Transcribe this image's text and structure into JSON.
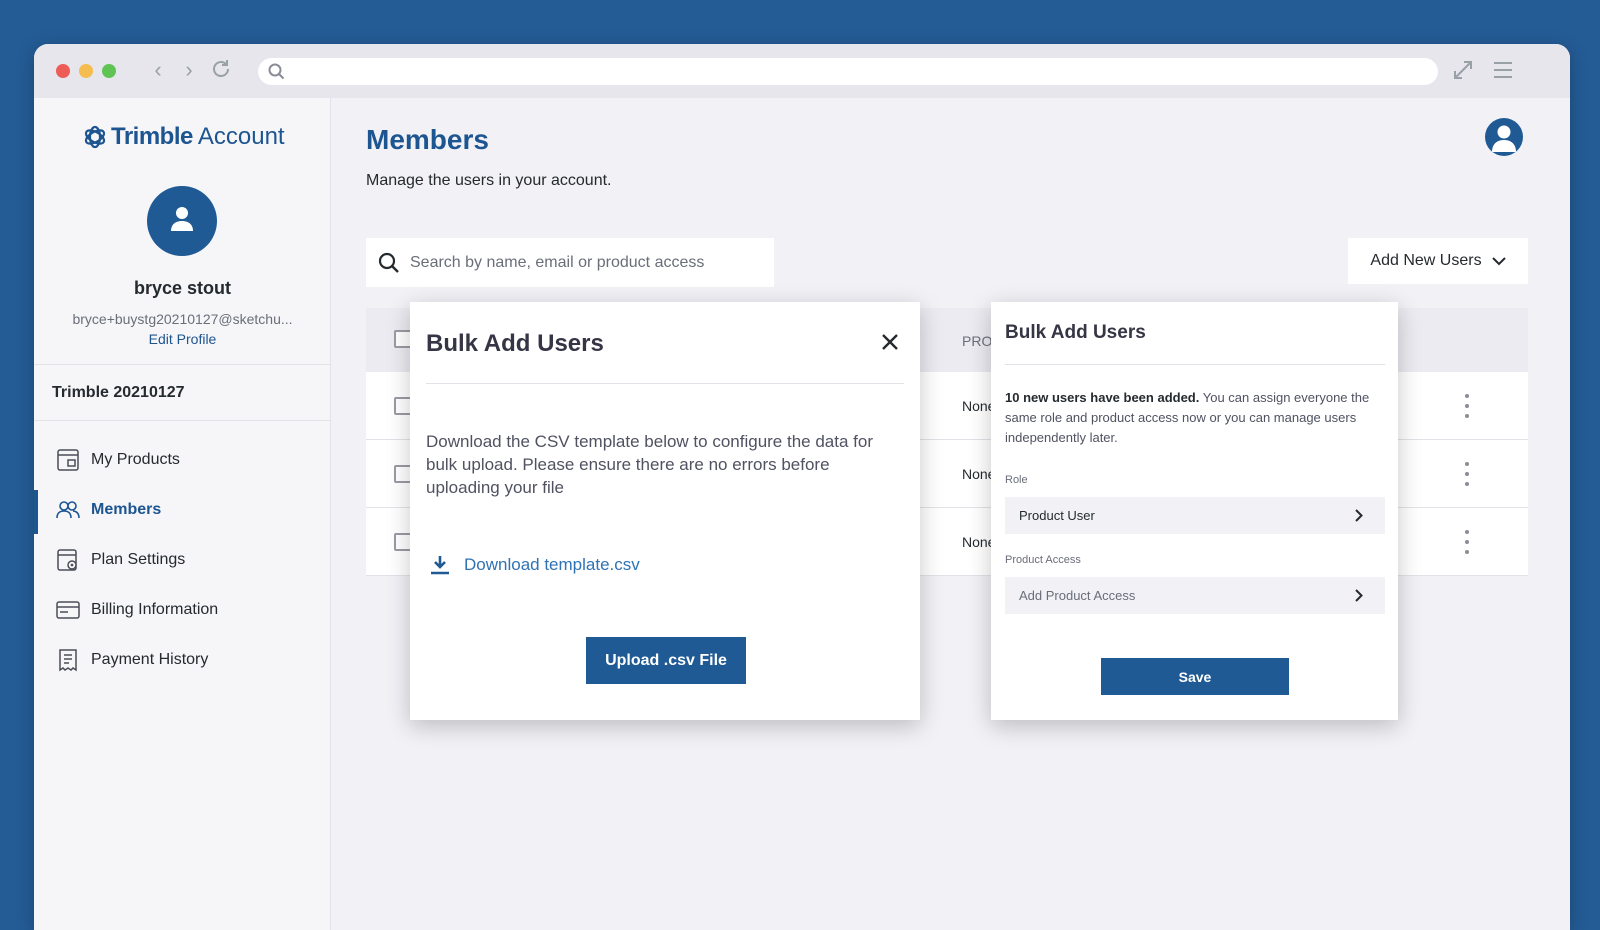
{
  "sidebar": {
    "brand": "Trimble",
    "brand_suffix": "Account",
    "user_name": "bryce stout",
    "user_email": "bryce+buystg20210127@sketchu...",
    "edit_profile": "Edit Profile",
    "account_name": "Trimble 20210127",
    "items": [
      {
        "label": "My Products",
        "icon": "products-icon"
      },
      {
        "label": "Members",
        "icon": "members-icon",
        "active": true
      },
      {
        "label": "Plan Settings",
        "icon": "plan-settings-icon"
      },
      {
        "label": "Billing Information",
        "icon": "billing-icon"
      },
      {
        "label": "Payment History",
        "icon": "receipt-icon"
      }
    ]
  },
  "main": {
    "title": "Members",
    "subtitle": "Manage the users in your account.",
    "search_placeholder": "Search by name, email or product access",
    "add_users_label": "Add New Users",
    "table": {
      "partial_column_header": "PROI",
      "rows": [
        {
          "product_access": "None"
        },
        {
          "product_access": "None"
        },
        {
          "product_access": "None"
        }
      ]
    }
  },
  "bulk_modal": {
    "title": "Bulk Add Users",
    "description": "Download the CSV template below to configure the data for bulk upload. Please ensure there are no errors before uploading your file",
    "download_label": "Download template.csv",
    "upload_label": "Upload .csv File"
  },
  "bulk_panel": {
    "title": "Bulk Add Users",
    "message_bold": "10 new users have been added.",
    "message_rest": " You can assign everyone the same role and product access now or you can manage users independently later.",
    "role_label": "Role",
    "role_value": "Product User",
    "access_label": "Product Access",
    "access_placeholder": "Add Product Access",
    "save_label": "Save"
  },
  "colors": {
    "page_background": "#245c96",
    "brand_blue": "#1d5590",
    "link_blue": "#2f73b5"
  }
}
